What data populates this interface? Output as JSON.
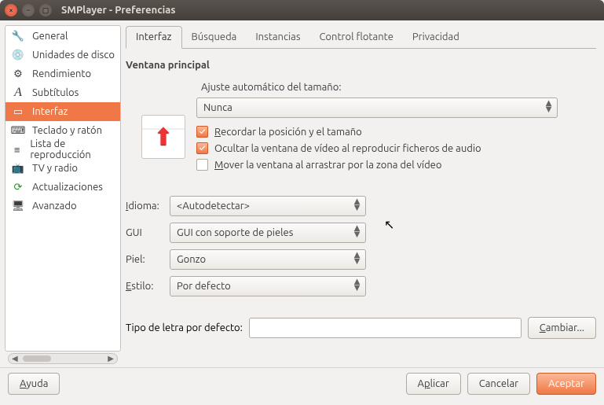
{
  "window": {
    "title": "SMPlayer - Preferencias"
  },
  "sidebar": {
    "items": [
      {
        "label": "General"
      },
      {
        "label": "Unidades de disco"
      },
      {
        "label": "Rendimiento"
      },
      {
        "label": "Subtítulos"
      },
      {
        "label": "Interfaz"
      },
      {
        "label": "Teclado y ratón"
      },
      {
        "label": "Lista de reproducción"
      },
      {
        "label": "TV y radio"
      },
      {
        "label": "Actualizaciones"
      },
      {
        "label": "Avanzado"
      }
    ]
  },
  "tabs": {
    "items": [
      {
        "label": "Interfaz"
      },
      {
        "label": "Búsqueda"
      },
      {
        "label": "Instancias"
      },
      {
        "label": "Control flotante"
      },
      {
        "label": "Privacidad"
      }
    ]
  },
  "mainwin": {
    "section": "Ventana principal",
    "autosize_label": "Ajuste automático del tamaño:",
    "autosize_value": "Nunca",
    "chk_remember": "Recordar la posición y el tamaño",
    "chk_hidevideo": "Ocultar la ventana de vídeo al reproducir ficheros de audio",
    "chk_movewin": "Mover la ventana al arrastrar por la zona del vídeo"
  },
  "form": {
    "lang_label": "Idioma:",
    "lang_value": "<Autodetectar>",
    "gui_label": "GUI",
    "gui_value": "GUI con soporte de pieles",
    "skin_label": "Piel:",
    "skin_value": "Gonzo",
    "style_label": "Estilo:",
    "style_value": "Por defecto",
    "font_label": "Tipo de letra por defecto:",
    "change_btn": "Cambiar..."
  },
  "footer": {
    "help": "Ayuda",
    "apply": "Aplicar",
    "cancel": "Cancelar",
    "accept": "Aceptar"
  }
}
